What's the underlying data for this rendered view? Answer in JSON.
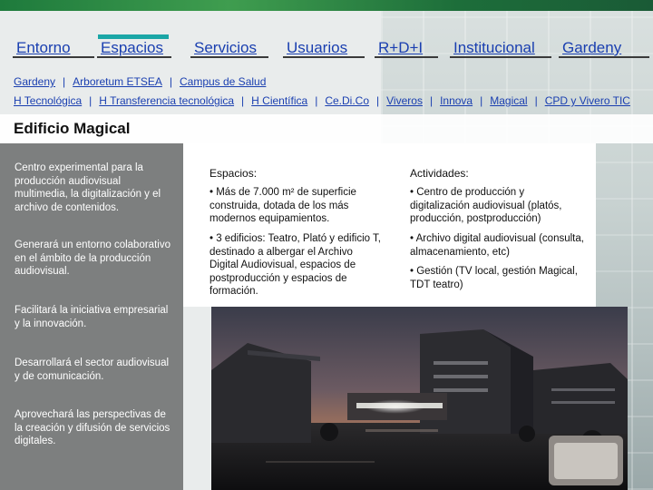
{
  "nav": [
    {
      "label": "Entorno"
    },
    {
      "label": "Espacios",
      "active": true
    },
    {
      "label": "Servicios"
    },
    {
      "label": "Usuarios"
    },
    {
      "label": "R+D+I"
    },
    {
      "label": "Institucional"
    },
    {
      "label": "Gardeny"
    }
  ],
  "subnav": {
    "row1": [
      "Gardeny",
      "Arboretum ETSEA",
      "Campus de Salud"
    ],
    "row2": [
      "H Tecnológica",
      "H Transferencia tecnológica",
      "H Científica",
      "Ce.Di.Co",
      "Viveros",
      "Innova",
      "Magical",
      "CPD y Vivero TIC"
    ],
    "separator": "|"
  },
  "page_title": "Edificio Magical",
  "left_panel": [
    "Centro experimental para la producción audiovisual multimedia, la digitalización y el archivo de contenidos.",
    "Generará un entorno colaborativo en el ámbito de la producción audiovisual.",
    "Facilitará la iniciativa empresarial y la innovación.",
    "Desarrollará el sector audiovisual y de comunicación.",
    "Aprovechará las perspectivas de la creación y difusión de servicios digitales."
  ],
  "info": {
    "espacios_head": "Espacios:",
    "espacios_1": "• Más de 7.000 m² de superficie construida, dotada de los más modernos equipamientos.",
    "espacios_2": "• 3 edificios: Teatro, Plató y edificio T, destinado a albergar el Archivo Digital Audiovisual, espacios de postproducción y espacios de formación.",
    "actividades_head": "Actividades:",
    "actividades_1": "• Centro de producción y digitalización audiovisual (platós, producción, postproducción)",
    "actividades_2": "• Archivo digital audiovisual (consulta, almacenamiento, etc)",
    "actividades_3": "• Gestión (TV local, gestión Magical, TDT teatro)"
  },
  "colors": {
    "link": "#1a3fb0",
    "active_tab": "#1aa6a6",
    "panel_gray": "#7d7f7f"
  }
}
